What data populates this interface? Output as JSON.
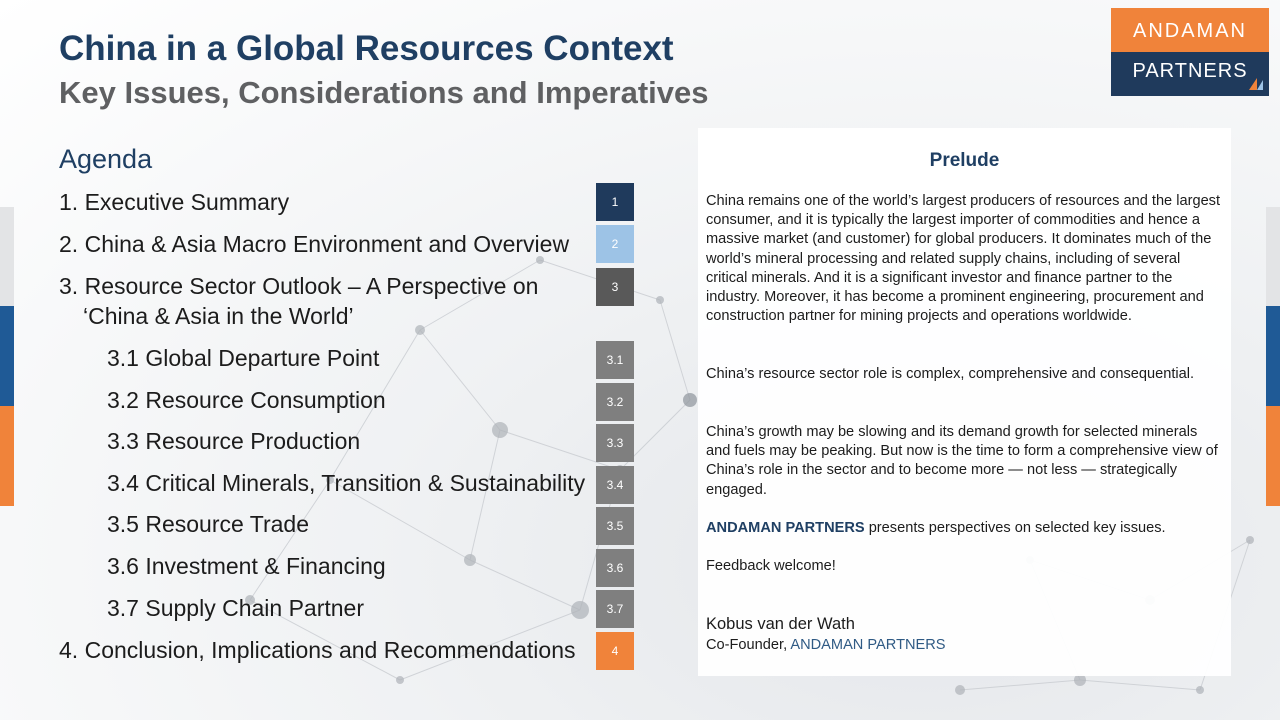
{
  "header": {
    "title": "China in a Global Resources Context",
    "subtitle": "Key Issues, Considerations and Imperatives"
  },
  "logo": {
    "line1": "ANDAMAN",
    "line2": "PARTNERS",
    "colors": {
      "top": "#f0833a",
      "bottom": "#1f3a5c"
    }
  },
  "agenda": {
    "title": "Agenda",
    "items": [
      {
        "num": "1.",
        "label": "Executive Summary",
        "badge": "1",
        "badge_color": "#1f3a5c"
      },
      {
        "num": "2.",
        "label": "China & Asia Macro Environment and Overview",
        "badge": "2",
        "badge_color": "#9dc3e6"
      },
      {
        "num": "3.",
        "label_line1": "Resource Sector Outlook – A Perspective on",
        "label_line2": "‘China & Asia in the World’",
        "badge": "3",
        "badge_color": "#595959"
      },
      {
        "label": "3.1 Global Departure Point",
        "badge": "3.1",
        "badge_color": "#7f7f7f"
      },
      {
        "label": "3.2 Resource Consumption",
        "badge": "3.2",
        "badge_color": "#7f7f7f"
      },
      {
        "label": "3.3 Resource Production",
        "badge": "3.3",
        "badge_color": "#7f7f7f"
      },
      {
        "label": "3.4 Critical Minerals, Transition & Sustainability",
        "badge": "3.4",
        "badge_color": "#7f7f7f"
      },
      {
        "label": "3.5 Resource Trade",
        "badge": "3.5",
        "badge_color": "#7f7f7f"
      },
      {
        "label": "3.6 Investment & Financing",
        "badge": "3.6",
        "badge_color": "#7f7f7f"
      },
      {
        "label": "3.7 Supply Chain Partner",
        "badge": "3.7",
        "badge_color": "#7f7f7f"
      },
      {
        "num": "4.",
        "label": "Conclusion, Implications and Recommendations",
        "badge": "4",
        "badge_color": "#f0833a"
      }
    ]
  },
  "prelude": {
    "title": "Prelude",
    "p1": "China remains one of the world’s largest producers of resources and the largest consumer, and it is typically the largest importer of commodities and hence a massive market (and customer) for global producers. It dominates much of the world’s mineral processing and related supply chains, including of several critical minerals. And it is a significant investor and finance partner to the industry. Moreover, it has become a prominent engineering, procurement and construction partner for mining projects and operations worldwide.",
    "p2": "China’s resource sector role is complex, comprehensive and consequential.",
    "p3": "China’s growth may be slowing and its demand growth for selected minerals and fuels may be peaking. But now is the time to form a comprehensive view of China’s role in the sector and to become more — not less — strategically engaged.",
    "p4_brand": "ANDAMAN PARTNERS",
    "p4_rest": " presents perspectives on selected key issues.",
    "p5": "Feedback welcome!",
    "signature_name": "Kobus van der Wath",
    "signature_role": "Co-Founder, ",
    "signature_company": "ANDAMAN PARTNERS"
  },
  "decor": {
    "edge_colors": {
      "grey": "#e3e4e6",
      "blue": "#1f5a96",
      "orange": "#f0833a"
    }
  }
}
